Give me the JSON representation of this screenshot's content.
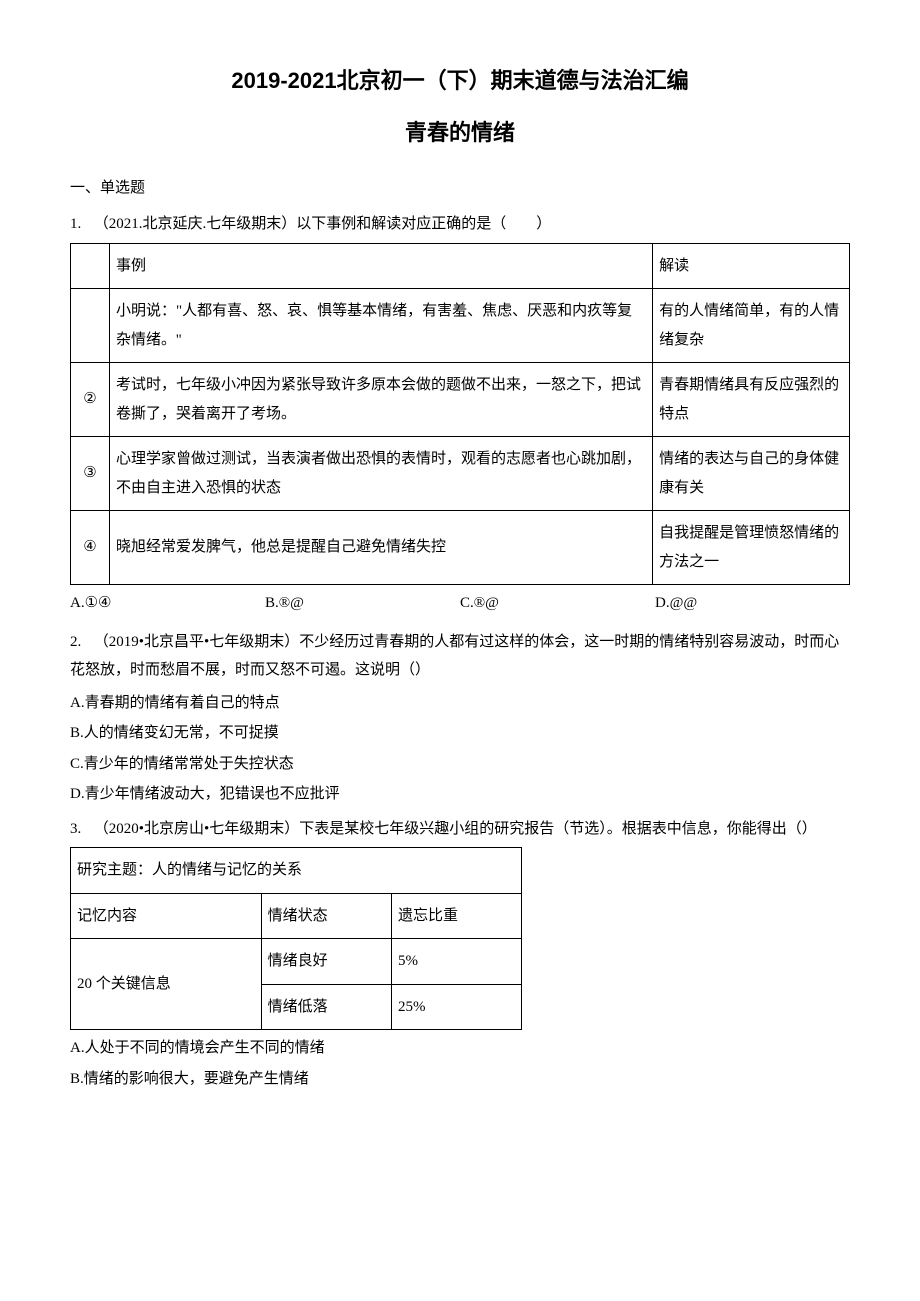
{
  "title": "2019-2021北京初一（下）期末道德与法治汇编",
  "subtitle": "青春的情绪",
  "section1": "一、单选题",
  "q1": {
    "num": "1.",
    "stem": "（2021.北京延庆.七年级期末）以下事例和解读对应正确的是（　　）",
    "header_case": "事例",
    "header_read": "解读",
    "rows": [
      {
        "idx": "",
        "case": "小明说：\"人都有喜、怒、哀、惧等基本情绪，有害羞、焦虑、厌恶和内疚等复杂情绪。''",
        "read": "有的人情绪简单，有的人情绪复杂"
      },
      {
        "idx": "②",
        "case": "考试时，七年级小冲因为紧张导致许多原本会做的题做不出来，一怒之下，把试卷撕了，哭着离开了考场。",
        "read": "青春期情绪具有反应强烈的特点"
      },
      {
        "idx": "③",
        "case": "心理学家曾做过测试，当表演者做出恐惧的表情时，观看的志愿者也心跳加剧，不由自主进入恐惧的状态",
        "read": "情绪的表达与自己的身体健康有关"
      },
      {
        "idx": "④",
        "case": "晓旭经常爱发脾气，他总是提醒自己避免情绪失控",
        "read": "自我提醒是管理愤怒情绪的方法之一"
      }
    ],
    "options": {
      "A": "A.①④",
      "B": "B.®@",
      "C": "C.®@",
      "D": "D.@@"
    }
  },
  "q2": {
    "num": "2.",
    "stem": "（2019•北京昌平•七年级期末）不少经历过青春期的人都有过这样的体会，这一时期的情绪特别容易波动，时而心花怒放，时而愁眉不展，时而又怒不可遏。这说明（）",
    "A": "A.青春期的情绪有着自己的特点",
    "B": "B.人的情绪变幻无常，不可捉摸",
    "C": "C.青少年的情绪常常处于失控状态",
    "D": "D.青少年情绪波动大，犯错误也不应批评"
  },
  "q3": {
    "num": "3.",
    "stem": "（2020•北京房山•七年级期末）下表是某校七年级兴趣小组的研究报告（节选）。根据表中信息，你能得出（）",
    "table_title": "研究主题：人的情绪与记忆的关系",
    "h1": "记忆内容",
    "h2": "情绪状态",
    "h3": "遗忘比重",
    "r1c1": "20 个关键信息",
    "r1c2": "情绪良好",
    "r1c3": "5%",
    "r2c2": "情绪低落",
    "r2c3": "25%",
    "A": "A.人处于不同的情境会产生不同的情绪",
    "B": "B.情绪的影响很大，要避免产生情绪"
  }
}
